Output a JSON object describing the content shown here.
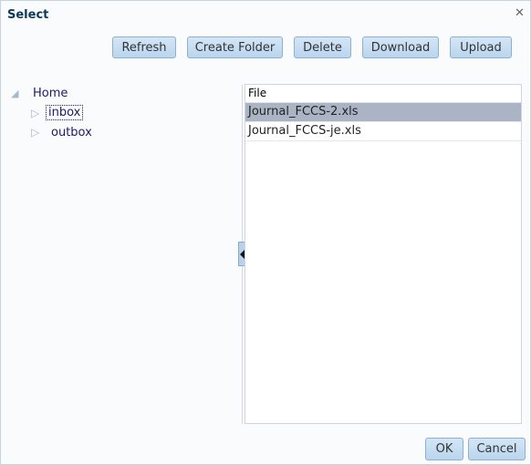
{
  "dialog": {
    "title": "Select",
    "close_icon": "close-icon"
  },
  "toolbar": {
    "refresh": "Refresh",
    "create_folder": "Create Folder",
    "delete": "Delete",
    "download": "Download",
    "upload": "Upload"
  },
  "tree": {
    "root": "Home",
    "children": [
      {
        "label": "inbox",
        "focused": true
      },
      {
        "label": "outbox"
      }
    ]
  },
  "files": {
    "header": "File",
    "rows": [
      {
        "name": "Journal_FCCS-2.xls",
        "selected": true
      },
      {
        "name": "Journal_FCCS-je.xls",
        "selected": false
      }
    ]
  },
  "footer": {
    "ok": "OK",
    "cancel": "Cancel"
  },
  "colors": {
    "title": "#0c3a59",
    "button": "#c6ddf2",
    "selected_row": "#aab4c4",
    "tree_text": "#1d1b6b"
  }
}
